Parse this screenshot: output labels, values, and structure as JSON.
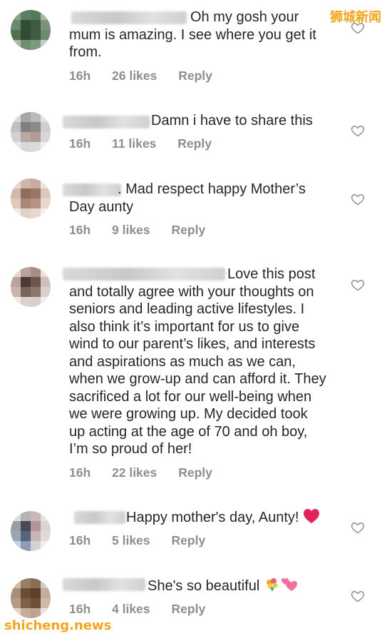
{
  "watermarks": {
    "top": "狮城新闻",
    "bottom": "shicheng.news"
  },
  "comments": [
    {
      "text": "Oh my gosh your\nmum is amazing. I see where you get it\nfrom.",
      "time": "16h",
      "likes": "26 likes",
      "reply": "Reply"
    },
    {
      "text": "Damn i have to share this",
      "time": "16h",
      "likes": "11 likes",
      "reply": "Reply"
    },
    {
      "text": ". Mad respect happy Mother’s\nDay aunty",
      "time": "16h",
      "likes": "9 likes",
      "reply": "Reply"
    },
    {
      "text": "Love this post\nand totally agree with your thoughts on\nseniors and leading active lifestyles. I\nalso think it’s important for us to give\nwind to our parent’s likes, and interests\nand aspirations as much as we can,\nwhen we grow-up and can afford it. They\nsacrificed a lot for our well-being when\nwe were growing up. My decided took\nup acting at the age of 70 and oh boy,\nI’m so proud of her!",
      "time": "16h",
      "likes": "22 likes",
      "reply": "Reply"
    },
    {
      "text": "Happy mother's day, Aunty!",
      "time": "16h",
      "likes": "5 likes",
      "reply": "Reply"
    },
    {
      "text": "She's so beautiful",
      "time": "16h",
      "likes": "4 likes",
      "reply": "Reply"
    }
  ],
  "icons": {
    "like": "heart-outline-icon",
    "red_heart": "red-heart-emoji",
    "bouquet": "bouquet-emoji",
    "two_hearts": "two-hearts-emoji"
  },
  "colors": {
    "text": "#262626",
    "meta": "#8e8e8e",
    "watermark": "#f4a51c",
    "red_heart": "#e0245e",
    "pink_hearts": "#f26fa2"
  }
}
